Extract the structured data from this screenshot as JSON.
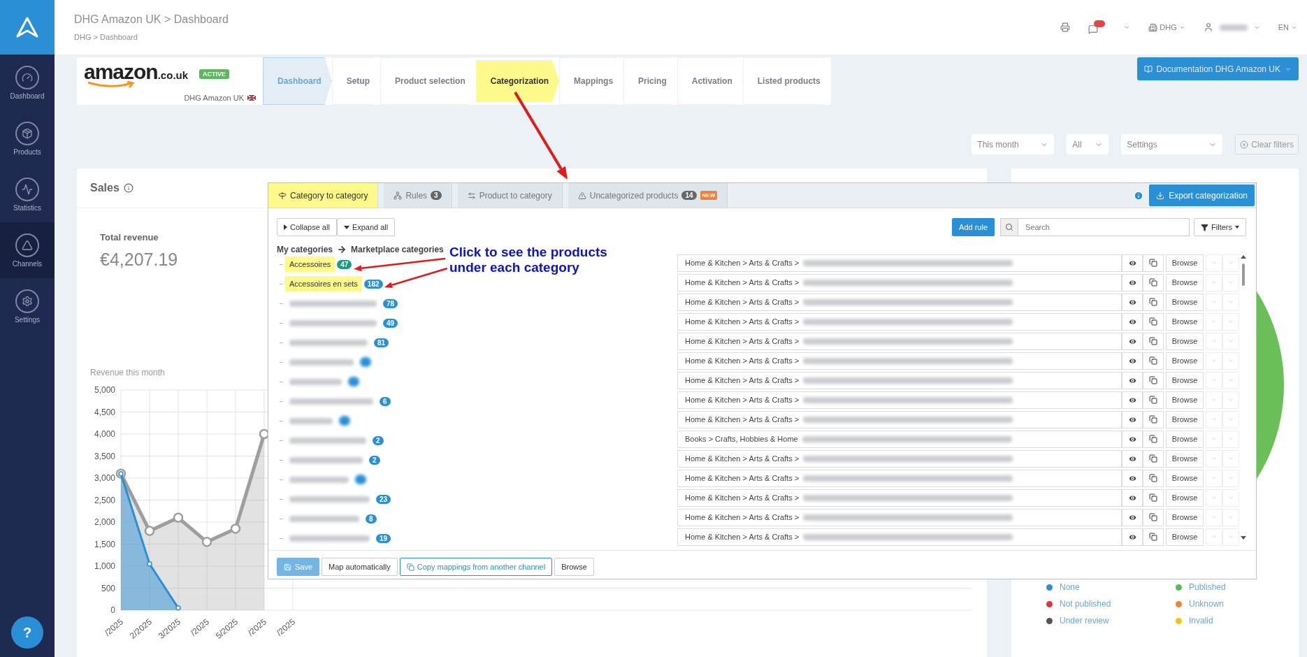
{
  "sidebar": {
    "items": [
      {
        "label": "Dashboard",
        "selected": false
      },
      {
        "label": "Products",
        "selected": false
      },
      {
        "label": "Statistics",
        "selected": false
      },
      {
        "label": "Channels",
        "selected": true
      },
      {
        "label": "Settings",
        "selected": false
      }
    ],
    "help": "?"
  },
  "header": {
    "title": "DHG Amazon UK > Dashboard",
    "breadcrumb": "DHG > Dashboard",
    "account": "DHG",
    "language": "EN"
  },
  "channel": {
    "logo": "amazon",
    "logo_suffix": ".co.uk",
    "status": "ACTIVE",
    "name": "DHG Amazon UK"
  },
  "steps": [
    {
      "label": "Dashboard",
      "selected": true,
      "highlighted": false
    },
    {
      "label": "Setup",
      "selected": false,
      "highlighted": false
    },
    {
      "label": "Product selection",
      "selected": false,
      "highlighted": false
    },
    {
      "label": "Categorization",
      "selected": false,
      "highlighted": true
    },
    {
      "label": "Mappings",
      "selected": false,
      "highlighted": false
    },
    {
      "label": "Pricing",
      "selected": false,
      "highlighted": false
    },
    {
      "label": "Activation",
      "selected": false,
      "highlighted": false
    },
    {
      "label": "Listed products",
      "selected": false,
      "highlighted": false
    }
  ],
  "documentation_button": "Documentation DHG Amazon UK",
  "filters": {
    "period": "This month",
    "scope": "All",
    "settings": "Settings",
    "clear": "Clear filters"
  },
  "sales": {
    "title": "Sales",
    "stat_label": "Total revenue",
    "stat_value": "€4,207.19",
    "chart_title": "Revenue this month",
    "chart_data": {
      "type": "area",
      "grid": true,
      "categories": [
        "/2025",
        "2/2025",
        "3/2025",
        "/2025",
        "5/2025",
        "/2025",
        "/2025"
      ],
      "ylim": [
        0,
        5000
      ],
      "yticks": [
        {
          "value": 0,
          "label": "0"
        },
        {
          "value": 500,
          "label": "500"
        },
        {
          "value": 1000,
          "label": "1,000"
        },
        {
          "value": 1500,
          "label": "1,500"
        },
        {
          "value": 2000,
          "label": "2,000"
        },
        {
          "value": 2500,
          "label": "2,500"
        },
        {
          "value": 3000,
          "label": "3,000"
        },
        {
          "value": 3500,
          "label": "3,500"
        },
        {
          "value": 4000,
          "label": "4,000"
        },
        {
          "value": 4500,
          "label": "4,500"
        },
        {
          "value": 5000,
          "label": "5,000"
        }
      ],
      "series": [
        {
          "color": "#9e9e9e",
          "values": [
            3100,
            1800,
            2100,
            1550,
            1850,
            4000,
            null
          ]
        },
        {
          "color": "#2b8fd6",
          "values": [
            3100,
            1050,
            50,
            null,
            null,
            null,
            null
          ]
        }
      ]
    }
  },
  "status_legend": [
    {
      "label": "None",
      "color": "#2b8fd6"
    },
    {
      "label": "Published",
      "color": "#5cb85c"
    },
    {
      "label": "Not published",
      "color": "#d9363e"
    },
    {
      "label": "Unknown",
      "color": "#f0803c"
    },
    {
      "label": "Under review",
      "color": "#555555"
    },
    {
      "label": "Invalid",
      "color": "#f2c21b"
    }
  ],
  "modal": {
    "tabs": [
      {
        "label": "Category to category",
        "selected": true
      },
      {
        "label": "Rules",
        "count": "3",
        "selected": false
      },
      {
        "label": "Product to category",
        "selected": false
      },
      {
        "label": "Uncategorized products",
        "count": "14",
        "tag": "NEW",
        "selected": false
      }
    ],
    "export_button": "Export categorization",
    "collapse": "Collapse all",
    "expand": "Expand all",
    "add_rule": "Add rule",
    "search_placeholder": "Search",
    "filters": "Filters",
    "heading_left": "My categories",
    "heading_right": "Marketplace categories",
    "categories": [
      {
        "name": "Accessoires",
        "count": "47",
        "color": "#1f9a7e",
        "highlighted": true
      },
      {
        "name": "Accessoires en sets",
        "count": "182",
        "color": "#2b8fd6",
        "highlighted": true
      },
      {
        "count": "78",
        "color": "#2b8fd6",
        "highlighted": false
      },
      {
        "count": "49",
        "color": "#2b8fd6",
        "highlighted": false
      },
      {
        "count": "81",
        "color": "#2b8fd6",
        "highlighted": false
      },
      {
        "color": "#2b8fd6",
        "highlighted": false
      },
      {
        "color": "#2b8fd6",
        "highlighted": false
      },
      {
        "count": "6",
        "color": "#2b8fd6",
        "highlighted": false
      },
      {
        "color": "#2b8fd6",
        "highlighted": false
      },
      {
        "count": "2",
        "color": "#2b8fd6",
        "highlighted": false
      },
      {
        "count": "2",
        "color": "#2b8fd6",
        "highlighted": false
      },
      {
        "color": "#2b8fd6",
        "highlighted": false
      },
      {
        "count": "23",
        "color": "#2b8fd6",
        "highlighted": false
      },
      {
        "count": "8",
        "color": "#2b8fd6",
        "highlighted": false
      },
      {
        "count": "19",
        "color": "#2b8fd6",
        "highlighted": false
      }
    ],
    "mappings": [
      {
        "path": "Home & Kitchen > Arts & Crafts >",
        "action": "Browse"
      },
      {
        "path": "Home & Kitchen > Arts & Crafts >",
        "action": "Browse"
      },
      {
        "path": "Home & Kitchen > Arts & Crafts >",
        "action": "Browse"
      },
      {
        "path": "Home & Kitchen > Arts & Crafts >",
        "action": "Browse"
      },
      {
        "path": "Home & Kitchen > Arts & Crafts >",
        "action": "Browse"
      },
      {
        "path": "Home & Kitchen > Arts & Crafts >",
        "action": "Browse"
      },
      {
        "path": "Home & Kitchen > Arts & Crafts >",
        "action": "Browse"
      },
      {
        "path": "Home & Kitchen > Arts & Crafts >",
        "action": "Browse"
      },
      {
        "path": "Home & Kitchen > Arts & Crafts >",
        "action": "Browse"
      },
      {
        "path": "Books > Crafts, Hobbies & Home",
        "action": "Browse"
      },
      {
        "path": "Home & Kitchen > Arts & Crafts >",
        "action": "Browse"
      },
      {
        "path": "Home & Kitchen > Arts & Crafts >",
        "action": "Browse"
      },
      {
        "path": "Home & Kitchen > Arts & Crafts >",
        "action": "Browse"
      },
      {
        "path": "Home & Kitchen > Arts & Crafts >",
        "action": "Browse"
      },
      {
        "path": "Home & Kitchen > Arts & Crafts >",
        "action": "Browse"
      }
    ],
    "footer": {
      "save": "Save",
      "save_disabled": true,
      "map_auto": "Map automatically",
      "copy": "Copy mappings from another channel",
      "browse": "Browse"
    }
  },
  "annotation": {
    "lines": [
      "Click to see the products",
      "under each category"
    ]
  }
}
